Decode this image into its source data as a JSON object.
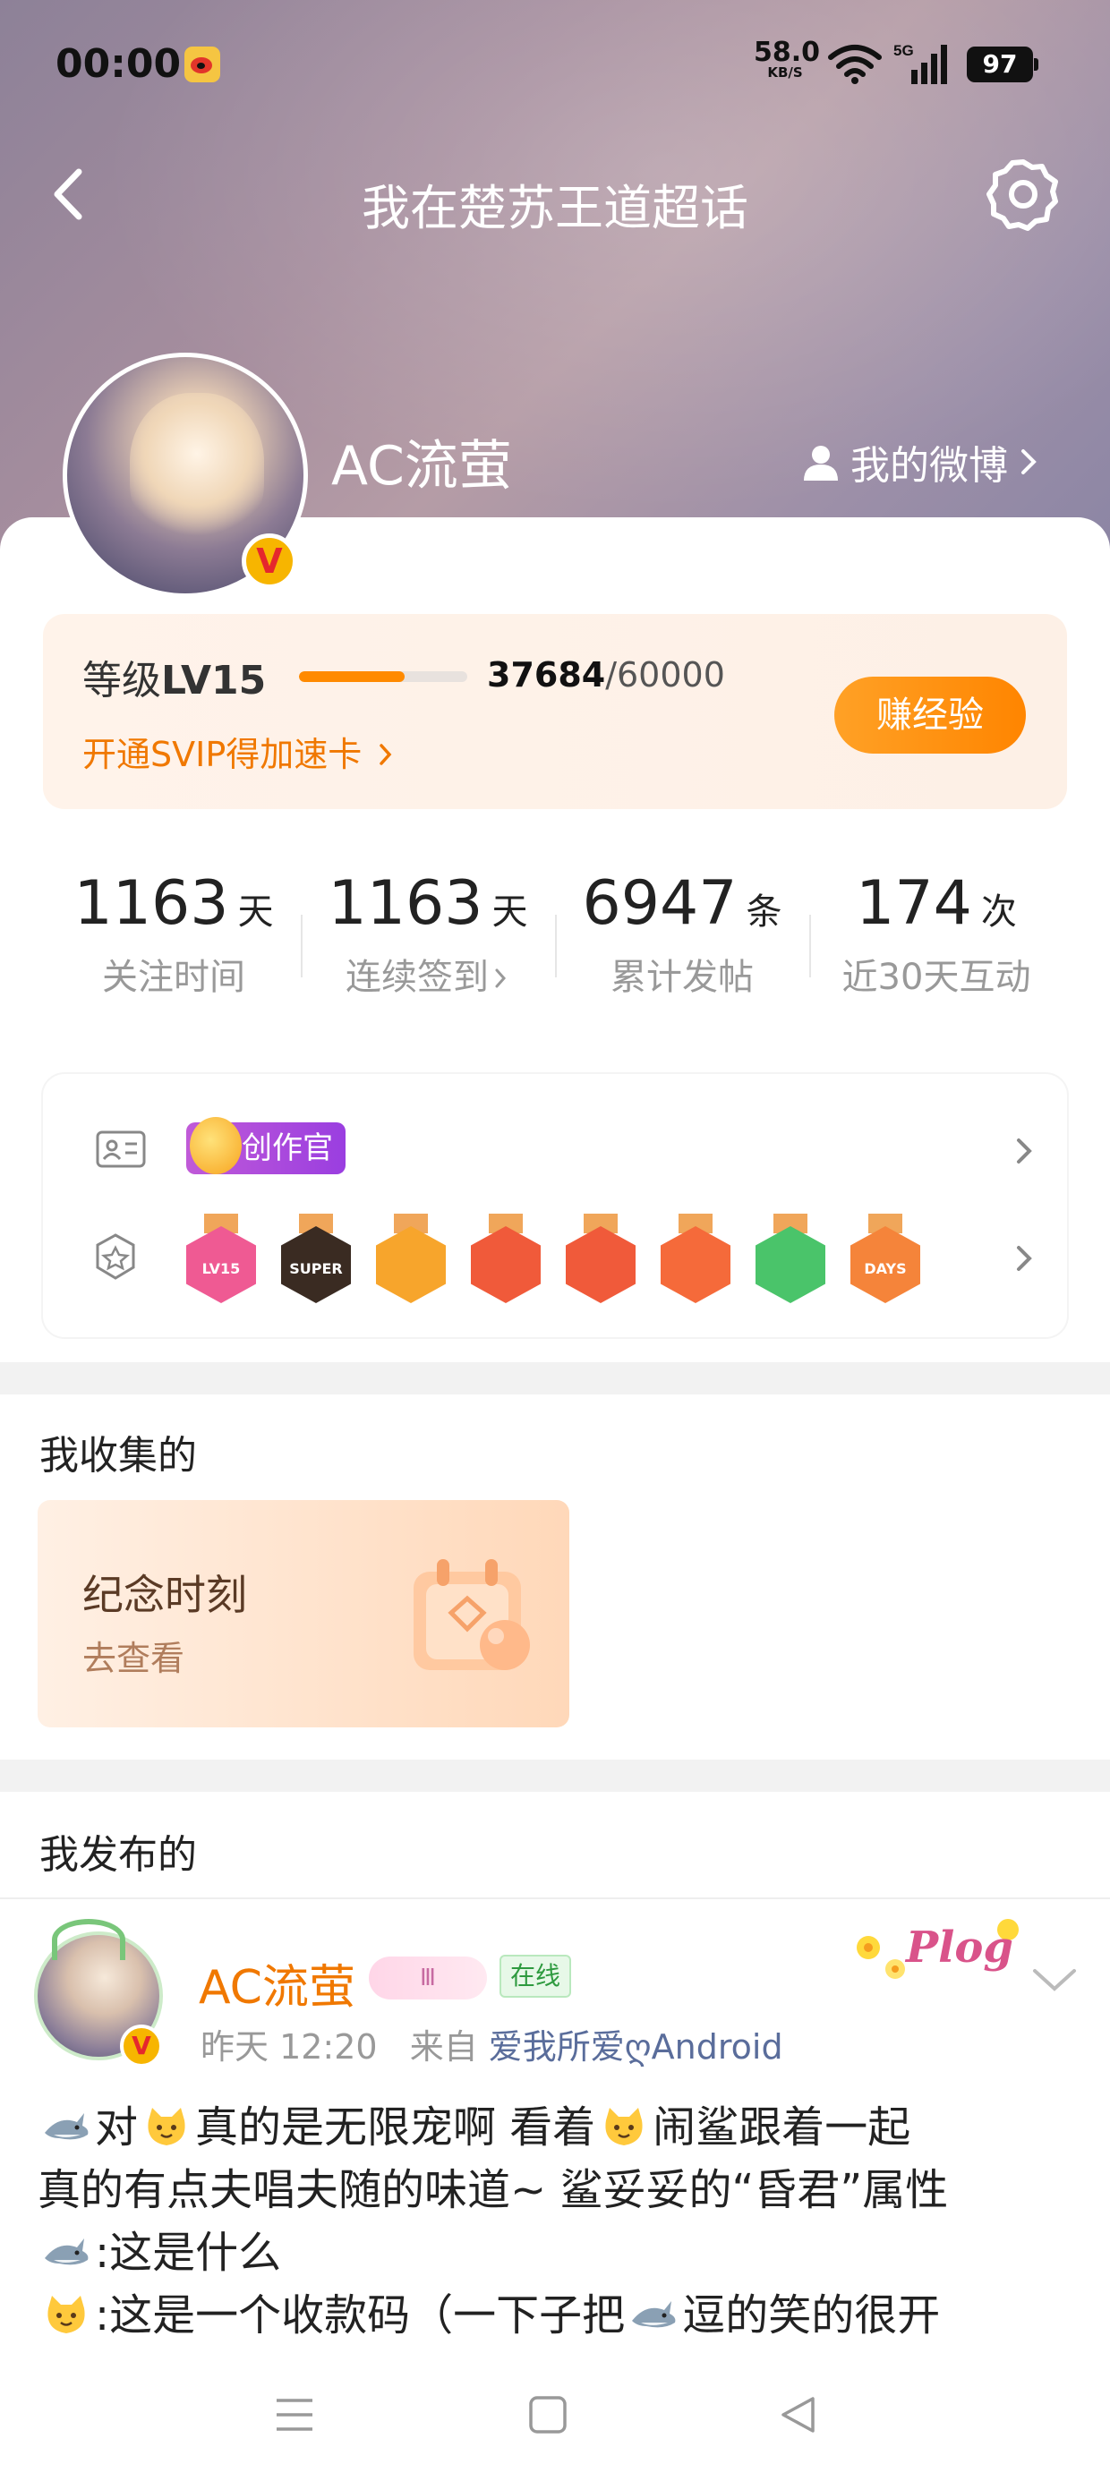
{
  "status_bar": {
    "time": "00:00",
    "net_speed": "58.0",
    "net_speed_unit": "KB/S",
    "network": "5G",
    "battery": "97"
  },
  "header": {
    "title": "我在楚苏王道超话"
  },
  "profile": {
    "username": "AC流萤",
    "my_weibo_label": "我的微博",
    "verified_mark": "V"
  },
  "level": {
    "label_prefix": "等级",
    "level": "LV15",
    "exp_current": "37684",
    "exp_total": "/60000",
    "progress": 0.628,
    "svip_link": "开通SVIP得加速卡",
    "earn_button": "赚经验"
  },
  "stats": [
    {
      "value": "1163",
      "unit": "天",
      "label": "关注时间"
    },
    {
      "value": "1163",
      "unit": "天",
      "label": "连续签到"
    },
    {
      "value": "6947",
      "unit": "条",
      "label": "累计发帖"
    },
    {
      "value": "174",
      "unit": "次",
      "label": "近30天互动"
    }
  ],
  "badges": {
    "creator_tag": "创作官",
    "medals": [
      {
        "icon": "lv15-medal",
        "label": "LV15",
        "color": "#ef5a93"
      },
      {
        "icon": "super-medal",
        "label": "SUPER",
        "color": "#3a2b22"
      },
      {
        "icon": "crown-medal",
        "label": "",
        "color": "#f7a52c"
      },
      {
        "icon": "cat-medal",
        "label": "",
        "color": "#f05a3a"
      },
      {
        "icon": "cat-face-medal",
        "label": "",
        "color": "#f05a3a"
      },
      {
        "icon": "fox-medal",
        "label": "",
        "color": "#f56a3a"
      },
      {
        "icon": "hand-medal",
        "label": "",
        "color": "#4ac46a"
      },
      {
        "icon": "100-days-medal",
        "label": "DAYS",
        "color": "#f5843a"
      }
    ]
  },
  "collected": {
    "title": "我收集的",
    "card_title": "纪念时刻",
    "card_link": "去查看"
  },
  "published": {
    "title": "我发布的"
  },
  "post": {
    "author": "AC流萤",
    "level_badge": "Ⅲ",
    "online_tag": "在线",
    "time": "昨天 12:20",
    "from_label": "来自",
    "source": "爱我所爱ღAndroid",
    "sticker": "Plog",
    "lines": [
      {
        "parts": [
          "shark",
          "对",
          "cat",
          "真的是无限宠啊 看着",
          "cat",
          "闹鲨跟着一起"
        ]
      },
      {
        "parts": [
          "真的有点夫唱夫随的味道~ 鲨妥妥的“昏君”属性"
        ]
      },
      {
        "parts": [
          "shark",
          ":这是什么"
        ]
      },
      {
        "parts": [
          "cat",
          ":这是一个收款码（一下子把",
          "shark",
          "逗的笑的很开"
        ]
      }
    ]
  },
  "colors": {
    "accent_orange": "#f07800",
    "button_orange": "#ff8a00",
    "source_blue": "#5a6d9b"
  }
}
